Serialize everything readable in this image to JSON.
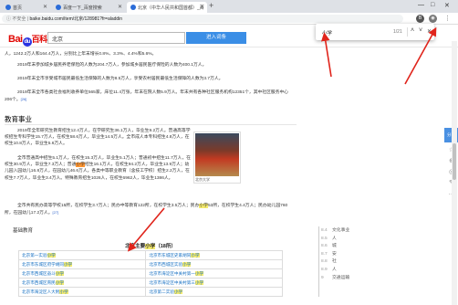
{
  "browser": {
    "tabs": [
      {
        "label": "首页",
        "active": false
      },
      {
        "label": "百度一下_百度搜索",
        "active": false
      },
      {
        "label": "北京（中华人民共和国首都）_百",
        "active": true
      }
    ],
    "new_tab": "+",
    "window_controls": [
      "—",
      "□",
      "✕"
    ],
    "security_label": "不安全",
    "url": "baike.baidu.com/item/北京/128981?fr=aladdin",
    "nav_back": "←",
    "nav_forward": "→",
    "nav_reload": "C"
  },
  "header": {
    "logo_part1": "Bai",
    "logo_paw": "du",
    "logo_part2": "百科",
    "search_value": "北京",
    "search_button": "进入词条"
  },
  "find_bar": {
    "query": "小学",
    "count": "1/21",
    "up": "˄",
    "down": "˅",
    "close": "✕"
  },
  "content": {
    "para_top": "人，1242.2万人和164.4万人，分别比上年末增长0.8%、3.3%、4.4%和5.6%。",
    "para_2": "2019年末参加城乡居民养老保险的人数为204.7万人，参加城乡居民医疗保险的人数为400.1万人。",
    "para_3": "2019年末全市享受城市居民最低生活保障的人数为8.5万人，享受农村居民最低生活保障的人数为3.7万人。",
    "para_4": "2019年末全市各类社会福利收养单位565家，床位11.4万张，年末在院人数5.9万人。年末共有各种社区服务机构12351个，其中社区服务中心206个。",
    "sup_4": "[26]",
    "section_title": "教育事业",
    "edu_1": "2019年全年研究生教育招生12.4万人，在学研究生36.1万人，毕业生9.2万人。普通高等学校招生专科学生15.7万人，在校生58.6万人，毕业生14.5万人。全市成人本专科招生4.8万人，在校生10.8万人，毕业生5.6万人。",
    "edu_2a": "全市普通高中招生5.1万人，在校生15.3万人，毕业生5.1万人；普通初中招生11.7万人，在校生30.9万人，毕业生7.3万人；普通",
    "edu_2hl": "小学",
    "edu_2b": "招生16.1万人，在校生94.2万人，毕业生13.9万人；幼儿园入园幼儿16.8万人，在园幼儿46.6万人。各类中等职业教育（含技工学校）招生2.2万人，在校生7.7万人，毕业生3.4万人。特殊教育招生1026人，在校生6962人，毕业生1386人。",
    "edu_3a": "全市共有民办高等学校15所，在校学生3.7万人；民办中等教育122所，在校学生3.5万人；民办",
    "edu_3hl": "小学",
    "edu_3b": "53所，在校学生4.4万人；民办幼儿园760所，在园幼儿17.2万人。",
    "sup_edu": "[27]",
    "campus_caption": "北京大学",
    "subsection": "基础教育",
    "table_title_a": "北京主要",
    "table_title_hl": "小学",
    "table_title_b": "（18所）",
    "table_rows": [
      [
        {
          "a": "北京第一实验",
          "hl": "小学"
        },
        {
          "a": "北京市东城区史家胡同",
          "hl": "小学"
        }
      ],
      [
        {
          "a": "北京市东城区府学胡同",
          "hl": "小学"
        },
        {
          "a": "北京市西城区实验",
          "hl": "小学"
        }
      ],
      [
        {
          "a": "北京市西城区奋斗",
          "hl": "小学"
        },
        {
          "a": "北京市海淀区中关村第一",
          "hl": "小学"
        }
      ],
      [
        {
          "a": "北京市西城区育民",
          "hl": "小学"
        },
        {
          "a": "北京市海淀区中关村第三",
          "hl": "小学"
        }
      ],
      [
        {
          "a": "北京市海淀区人大附",
          "hl": "小学"
        },
        {
          "a": "北京第二实验",
          "hl": "小学"
        }
      ]
    ]
  },
  "right_nav": [
    {
      "num": "8.4",
      "label": "文化事业"
    },
    {
      "num": "8.5",
      "label": "人"
    },
    {
      "num": "8.6",
      "label": "城"
    },
    {
      "num": "8.7",
      "label": "安"
    },
    {
      "num": "8.8",
      "label": "社"
    },
    {
      "num": "8.9",
      "label": "人"
    },
    {
      "num": "9",
      "label": "交通运输"
    }
  ],
  "side_tools": {
    "share": "分享",
    "icons": [
      "☆",
      "⊕",
      "◎",
      "✎",
      "…"
    ]
  },
  "colors": {
    "baidu_red": "#e10602",
    "baidu_blue": "#2932e1",
    "button_blue": "#3a8ee6",
    "highlight": "#f4ea6e",
    "current_match": "#ff9632",
    "link": "#136ec2",
    "arrow": "#e0241b"
  }
}
